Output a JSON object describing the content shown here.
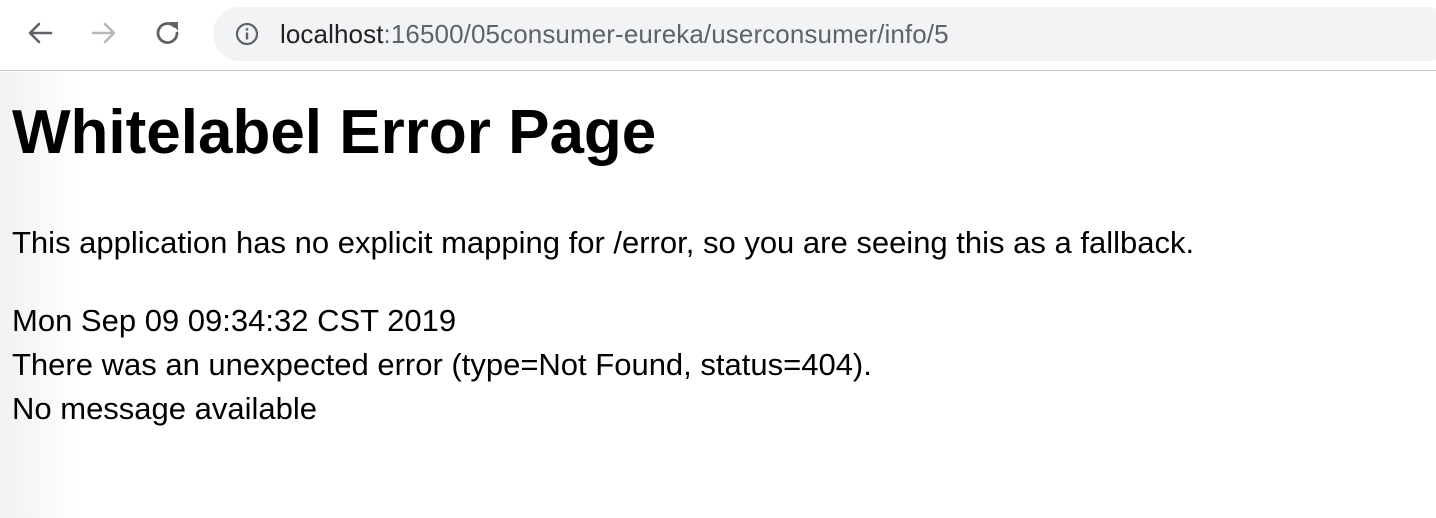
{
  "browser": {
    "back_icon": "arrow-left-icon",
    "forward_icon": "arrow-right-icon",
    "reload_icon": "reload-icon",
    "info_icon": "info-circle-icon",
    "url_host": "localhost",
    "url_rest": ":16500/05consumer-eureka/userconsumer/info/5"
  },
  "page": {
    "title": "Whitelabel Error Page",
    "description": "This application has no explicit mapping for /error, so you are seeing this as a fallback.",
    "timestamp": "Mon Sep 09 09:34:32 CST 2019",
    "error_line": "There was an unexpected error (type=Not Found, status=404).",
    "message": "No message available"
  }
}
